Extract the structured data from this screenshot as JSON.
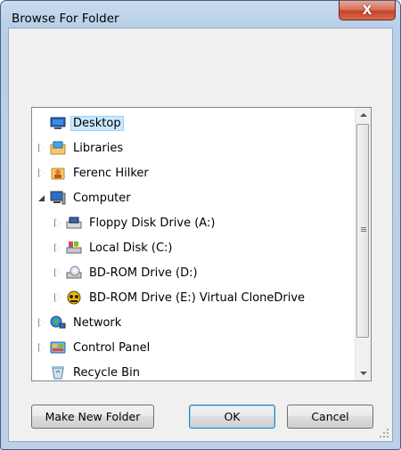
{
  "window": {
    "title": "Browse For Folder",
    "close_glyph": "X"
  },
  "tree": {
    "items": [
      {
        "label": "Desktop",
        "icon": "desktop-icon",
        "level": 0,
        "expander": "none",
        "selected": true
      },
      {
        "label": "Libraries",
        "icon": "libraries-icon",
        "level": 0,
        "expander": "collapsed",
        "selected": false
      },
      {
        "label": "Ferenc Hilker",
        "icon": "user-folder-icon",
        "level": 0,
        "expander": "collapsed",
        "selected": false
      },
      {
        "label": "Computer",
        "icon": "computer-icon",
        "level": 0,
        "expander": "expanded",
        "selected": false
      },
      {
        "label": "Floppy Disk Drive (A:)",
        "icon": "floppy-drive-icon",
        "level": 1,
        "expander": "collapsed",
        "selected": false
      },
      {
        "label": "Local Disk (C:)",
        "icon": "local-disk-icon",
        "level": 1,
        "expander": "collapsed",
        "selected": false
      },
      {
        "label": "BD-ROM Drive (D:)",
        "icon": "bd-rom-drive-icon",
        "level": 1,
        "expander": "collapsed",
        "selected": false
      },
      {
        "label": "BD-ROM Drive (E:) Virtual CloneDrive",
        "icon": "clonedrive-icon",
        "level": 1,
        "expander": "collapsed",
        "selected": false
      },
      {
        "label": "Network",
        "icon": "network-icon",
        "level": 0,
        "expander": "collapsed",
        "selected": false
      },
      {
        "label": "Control Panel",
        "icon": "control-panel-icon",
        "level": 0,
        "expander": "collapsed",
        "selected": false
      },
      {
        "label": "Recycle Bin",
        "icon": "recycle-bin-icon",
        "level": 0,
        "expander": "none",
        "selected": false
      }
    ]
  },
  "buttons": {
    "new_folder": "Make New Folder",
    "ok": "OK",
    "cancel": "Cancel"
  },
  "colors": {
    "selection_bg": "#cce8ff",
    "selection_border": "#99d1ff",
    "close_button": "#c4442b"
  }
}
